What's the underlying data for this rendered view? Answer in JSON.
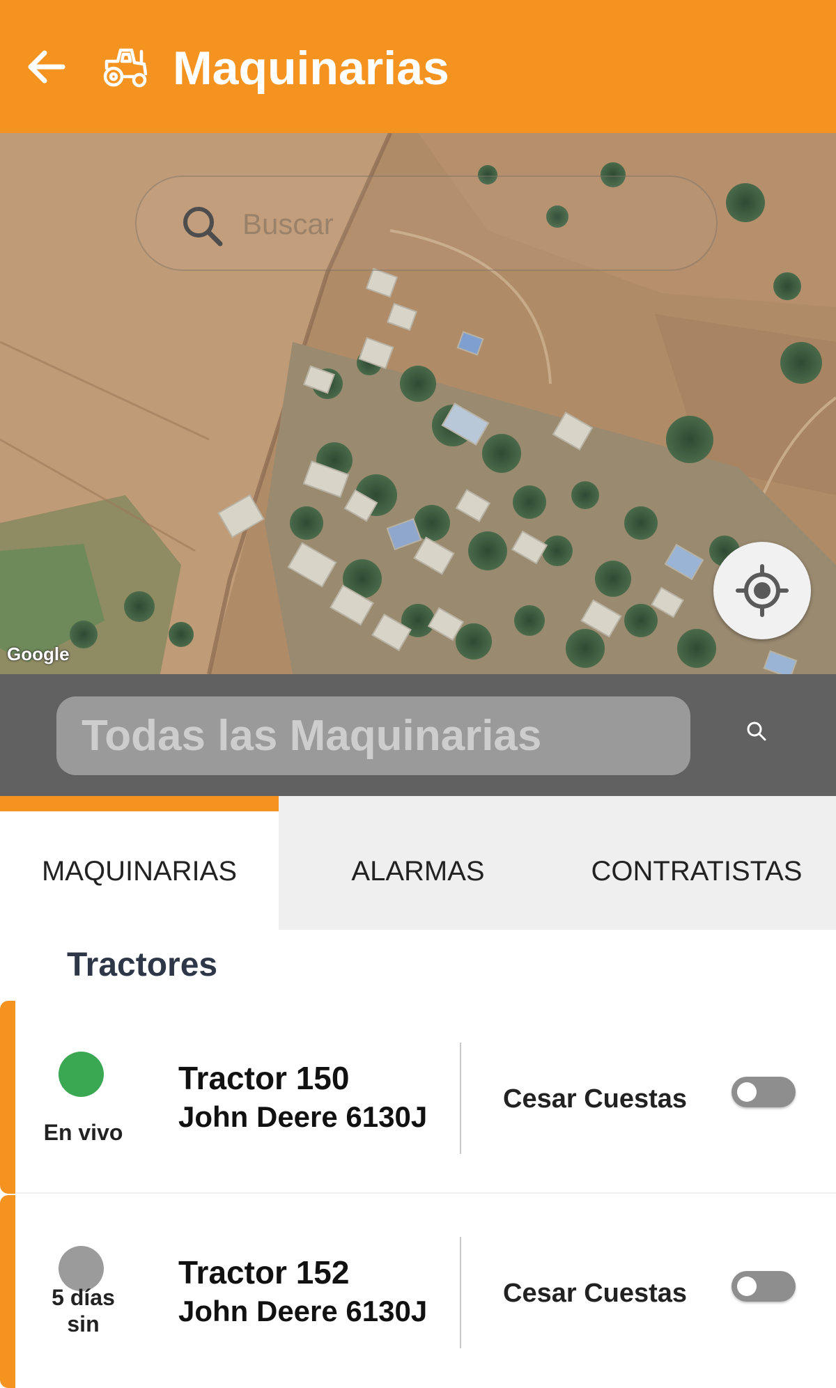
{
  "appbar": {
    "title": "Maquinarias",
    "back_icon": "arrow-left-icon",
    "app_icon": "tractor-icon",
    "color": "#f59321"
  },
  "map": {
    "search_placeholder": "Buscar",
    "attribution": "Google",
    "locate_icon": "crosshair-icon"
  },
  "filter": {
    "placeholder": "Todas las Maquinarias",
    "search_icon": "search-icon"
  },
  "tabs": [
    {
      "label": "MAQUINARIAS",
      "active": true
    },
    {
      "label": "ALARMAS",
      "active": false
    },
    {
      "label": "CONTRATISTAS",
      "active": false
    }
  ],
  "section": {
    "title": "Tractores"
  },
  "machines": [
    {
      "status_text": "En vivo",
      "status_color": "#3aa853",
      "name": "Tractor 150",
      "model": "John Deere 6130J",
      "contractor": "Cesar Cuestas",
      "toggle_on": false
    },
    {
      "status_text": "5 días sin",
      "status_color": "#9b9b9b",
      "name": "Tractor 152",
      "model": "John Deere 6130J",
      "contractor": "Cesar Cuestas",
      "toggle_on": false
    }
  ]
}
